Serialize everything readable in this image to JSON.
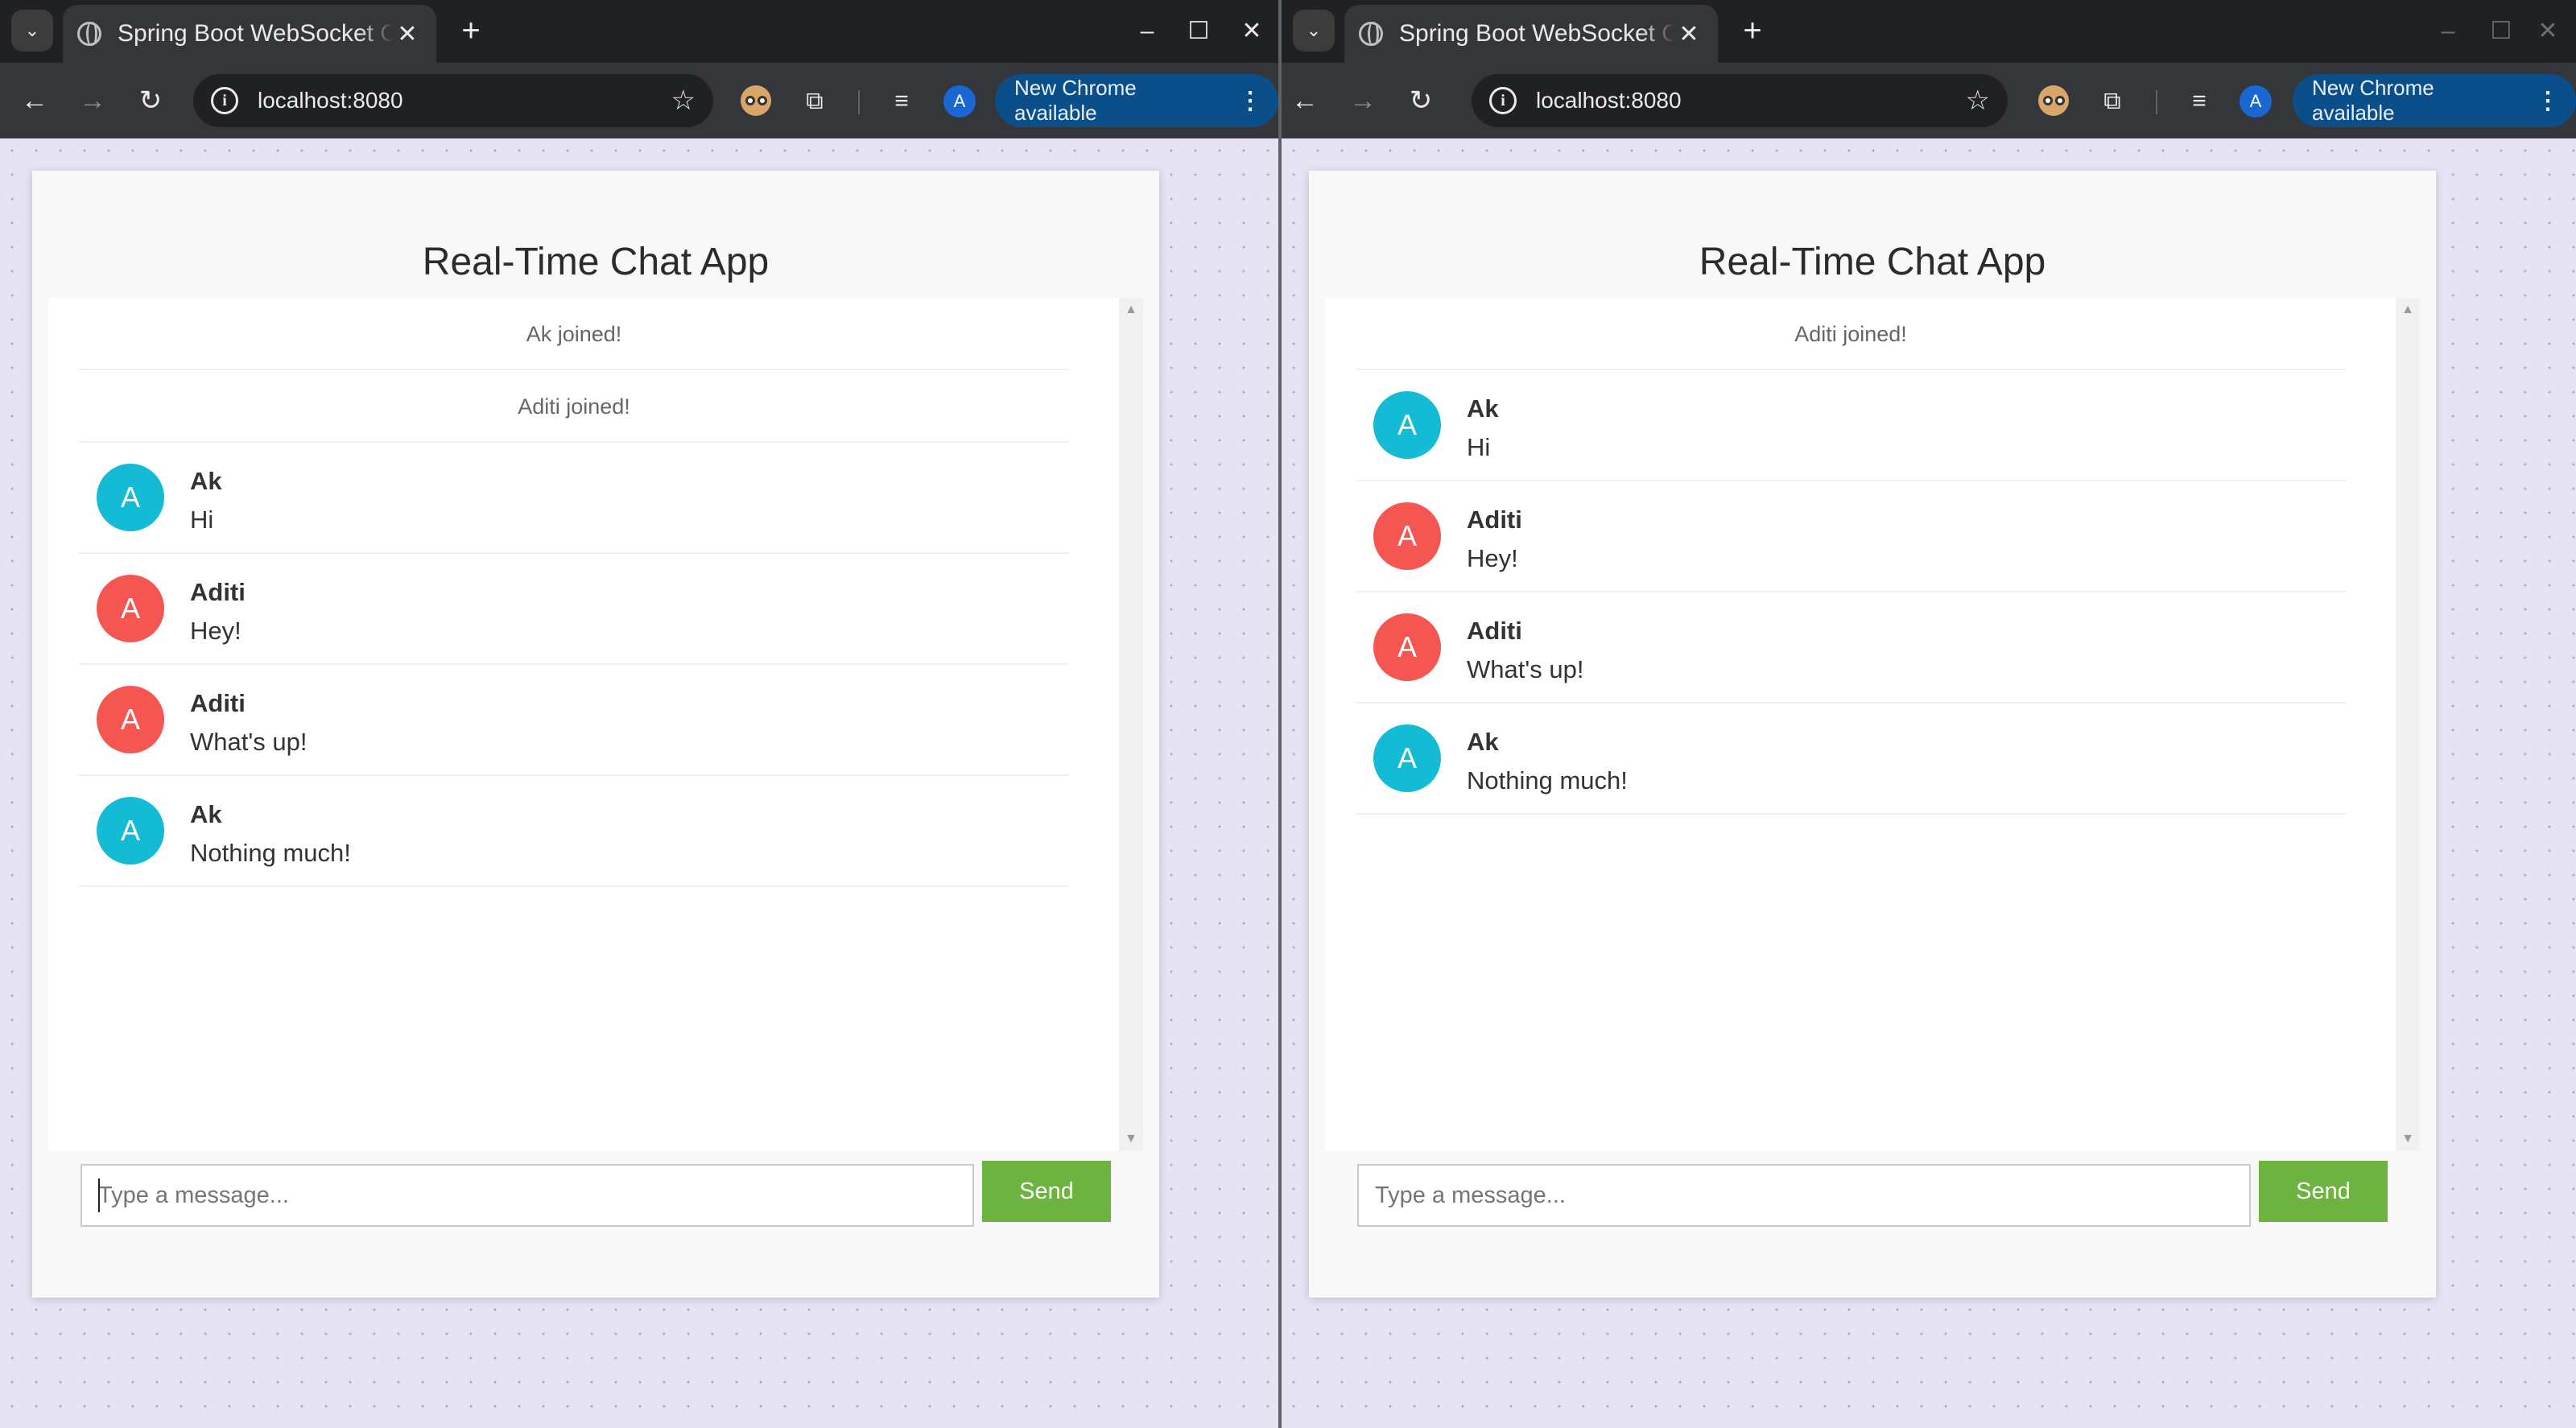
{
  "windows": [
    {
      "tab_title": "Spring Boot WebSocket Chat",
      "url": "localhost:8080",
      "update_label": "New Chrome available",
      "profile_initial": "A",
      "app": {
        "title": "Real-Time Chat App",
        "events": [
          "Ak joined!",
          "Aditi joined!"
        ],
        "messages": [
          {
            "avatar": "A",
            "sender": "Ak",
            "text": "Hi",
            "color": "#13bcd4"
          },
          {
            "avatar": "A",
            "sender": "Aditi",
            "text": "Hey!",
            "color": "#f65651"
          },
          {
            "avatar": "A",
            "sender": "Aditi",
            "text": "What's up!",
            "color": "#f65651"
          },
          {
            "avatar": "A",
            "sender": "Ak",
            "text": "Nothing much!",
            "color": "#13bcd4"
          }
        ],
        "input_placeholder": "Type a message...",
        "send_label": "Send"
      }
    },
    {
      "tab_title": "Spring Boot WebSocket Chat",
      "url": "localhost:8080",
      "update_label": "New Chrome available",
      "profile_initial": "A",
      "app": {
        "title": "Real-Time Chat App",
        "events": [
          "Aditi joined!"
        ],
        "messages": [
          {
            "avatar": "A",
            "sender": "Ak",
            "text": "Hi",
            "color": "#13bcd4"
          },
          {
            "avatar": "A",
            "sender": "Aditi",
            "text": "Hey!",
            "color": "#f65651"
          },
          {
            "avatar": "A",
            "sender": "Aditi",
            "text": "What's up!",
            "color": "#f65651"
          },
          {
            "avatar": "A",
            "sender": "Ak",
            "text": "Nothing much!",
            "color": "#13bcd4"
          }
        ],
        "input_placeholder": "Type a message...",
        "send_label": "Send"
      }
    }
  ],
  "colors": {
    "send_button": "#6db33f",
    "avatar_ak": "#13bcd4",
    "avatar_aditi": "#f65651",
    "page_background": "#e6e4f4"
  },
  "icons": {
    "tab_search": "chevron-down-icon",
    "favicon": "globe-icon",
    "close": "close-icon",
    "new_tab": "plus-icon",
    "back": "arrow-left-icon",
    "forward": "arrow-right-icon",
    "reload": "reload-icon",
    "site_info": "info-icon",
    "bookmark": "star-icon",
    "extension": "owl-extension-icon",
    "extensions": "puzzle-icon",
    "media": "media-controls-icon",
    "menu": "kebab-menu-icon"
  }
}
